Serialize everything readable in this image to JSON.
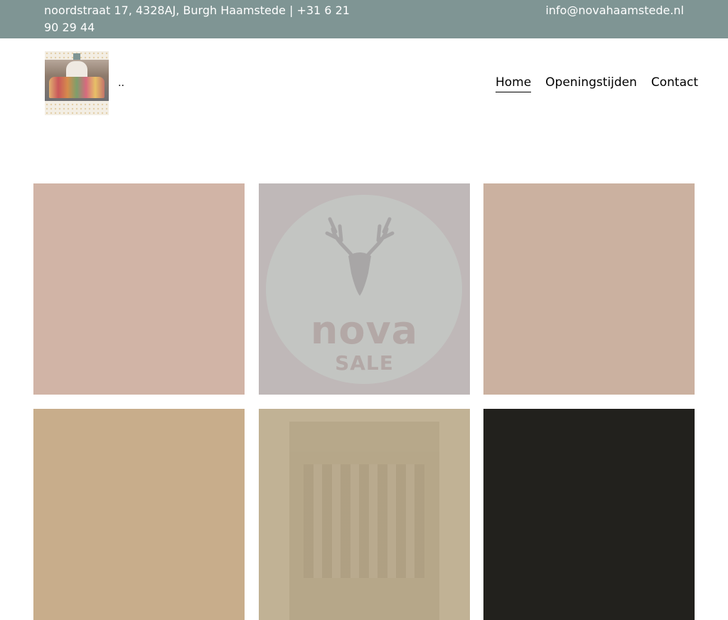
{
  "topbar": {
    "address": "noordstraat 17, 4328AJ, Burgh Haamstede | +31 6 21 90 29 44",
    "email": "info@novahaamstede.nl"
  },
  "header": {
    "logo": "store-photo-logo",
    "site_title": ".."
  },
  "nav": {
    "items": [
      {
        "label": "Home",
        "active": true
      },
      {
        "label": "Openingstijden",
        "active": false
      },
      {
        "label": "Contact",
        "active": false
      }
    ]
  },
  "gallery": {
    "tiles": [
      {
        "color": "#d1b4a6"
      },
      {
        "color": "#bfb8b8",
        "logo_text": "nova",
        "sale_text": "SALE",
        "icon": "deer-head-icon"
      },
      {
        "color": "#cbb1a0"
      },
      {
        "color": "#c8ad8b"
      },
      {
        "color": "#c1b295"
      },
      {
        "color": "#22211d"
      }
    ]
  }
}
